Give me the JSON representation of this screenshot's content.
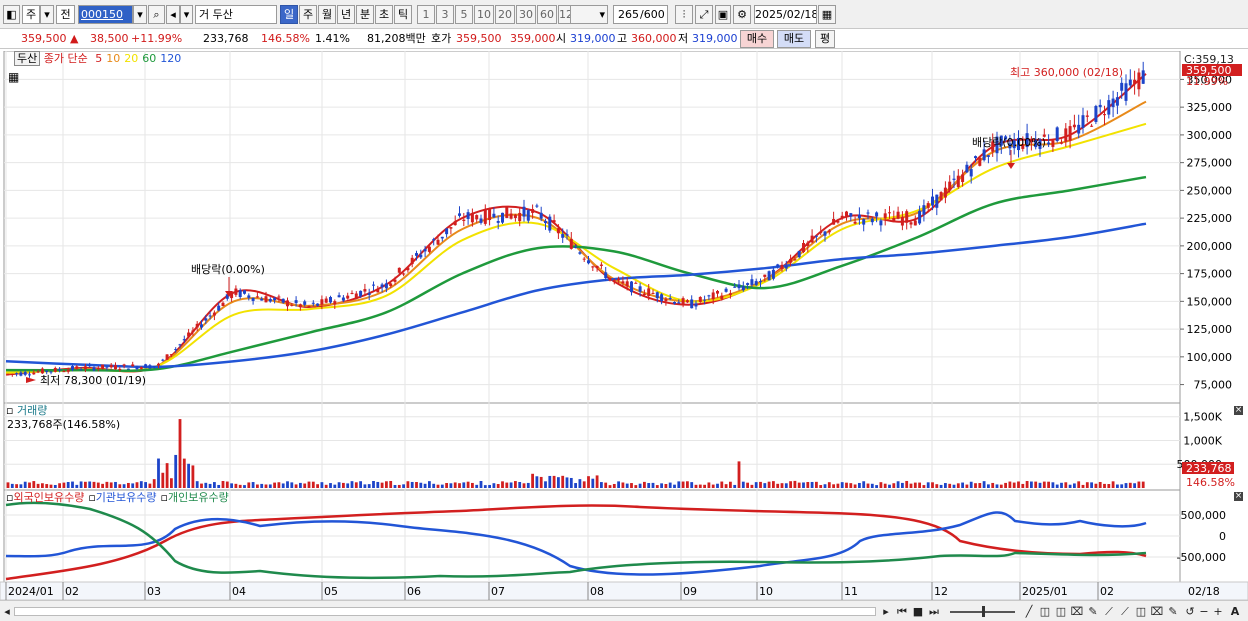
{
  "toolbar": {
    "market": "주",
    "prev": "전",
    "code": "000150",
    "name_prefix": "거",
    "name": "두산",
    "periods": [
      "일",
      "주",
      "월",
      "년",
      "분",
      "초",
      "틱"
    ],
    "active_period": "일",
    "intervals": [
      "1",
      "3",
      "5",
      "10",
      "20",
      "30",
      "60",
      "120"
    ],
    "count": "265",
    "count_max": "/600",
    "date": "2025/02/18"
  },
  "quote": {
    "price": "359,500",
    "change_symbol": "▲",
    "change": "38,500",
    "change_rate": "+11.99%",
    "volume": "233,768",
    "volume_rate": "146.58%",
    "turnover": "1.41%",
    "amount": "81,208백만",
    "ask_label": "호가",
    "ask": "359,500",
    "bid": "359,000",
    "open_label": "시",
    "open": "319,000",
    "high_label": "고",
    "high": "360,000",
    "low_label": "저",
    "low": "319,000",
    "buy_label": "매수",
    "sell_label": "매도",
    "eval_label": "평"
  },
  "price_panel": {
    "stock_label": "두산",
    "ma_label": "종가 단순",
    "ma_periods": [
      "5",
      "10",
      "20",
      "60",
      "120"
    ],
    "ma_colors": [
      "#d21f1f",
      "#e88a1a",
      "#f2e200",
      "#1f9a3c",
      "#2255d6"
    ],
    "last_close_label": "C:359,13",
    "last_price_tag": "359,500",
    "last_rate_tag": "11.99%",
    "high_note": "최고 360,000 (02/18)",
    "low_note": "최저 78,300 (01/19)",
    "dividend_note_1": "배당락(0.00%)",
    "dividend_note_2": "배당락(0.00%)"
  },
  "volume_panel": {
    "label": "거래량",
    "value_label": "233,768주(146.58%)",
    "tag_value": "233,768",
    "tag_rate": "146.58%"
  },
  "holdings_panel": {
    "labels": [
      "외국인보유수량",
      "기관보유수량",
      "개인보유수량"
    ],
    "colors": [
      "#d21f1f",
      "#2255d6",
      "#1f8a4c"
    ]
  },
  "x_axis": [
    "2024/01",
    "02",
    "03",
    "04",
    "05",
    "06",
    "07",
    "08",
    "09",
    "10",
    "11",
    "12",
    "2025/01",
    "02"
  ],
  "x_axis_right": "02/18",
  "colors": {
    "up": "#d21f1f",
    "down": "#1d44c9",
    "grid": "#e6e6e6"
  },
  "chart_data": [
    {
      "type": "line",
      "title": "",
      "yticks": [
        "75,000",
        "100,000",
        "125,000",
        "150,000",
        "175,000",
        "200,000",
        "225,000",
        "250,000",
        "275,000",
        "300,000",
        "325,000",
        "350,000"
      ],
      "ylim": [
        62000,
        372000
      ],
      "x_months": [
        "2024/01",
        "02",
        "03",
        "04",
        "05",
        "06",
        "07",
        "08",
        "09",
        "10",
        "11",
        "12",
        "2025/01",
        "02"
      ],
      "series": [
        {
          "name": "5",
          "values": [
            84000,
            90000,
            92000,
            158000,
            145000,
            165000,
            225000,
            230000,
            168000,
            147000,
            170000,
            225000,
            225000,
            290000,
            300000,
            355000
          ]
        },
        {
          "name": "10",
          "values": [
            85000,
            89000,
            92000,
            150000,
            146000,
            160000,
            215000,
            225000,
            170000,
            150000,
            170000,
            220000,
            230000,
            285000,
            295000,
            330000
          ]
        },
        {
          "name": "20",
          "values": [
            86000,
            88000,
            92000,
            138000,
            143000,
            155000,
            205000,
            220000,
            180000,
            150000,
            168000,
            215000,
            232000,
            270000,
            290000,
            310000
          ]
        },
        {
          "name": "60",
          "values": [
            88000,
            88000,
            89000,
            105000,
            122000,
            140000,
            175000,
            198000,
            195000,
            175000,
            162000,
            182000,
            208000,
            238000,
            250000,
            262000
          ]
        },
        {
          "name": "120",
          "values": [
            96000,
            93000,
            91000,
            96000,
            105000,
            120000,
            140000,
            160000,
            170000,
            174000,
            180000,
            188000,
            193000,
            200000,
            208000,
            220000
          ]
        }
      ]
    },
    {
      "type": "bar",
      "title": "",
      "yticks": [
        "500,000",
        "1,000K",
        "1,500K"
      ],
      "ylim": [
        0,
        1620000
      ]
    },
    {
      "type": "line",
      "title": "",
      "yticks": [
        "500,000",
        "0",
        "-500,000"
      ],
      "ylim": [
        -1000000,
        1000000
      ]
    }
  ]
}
